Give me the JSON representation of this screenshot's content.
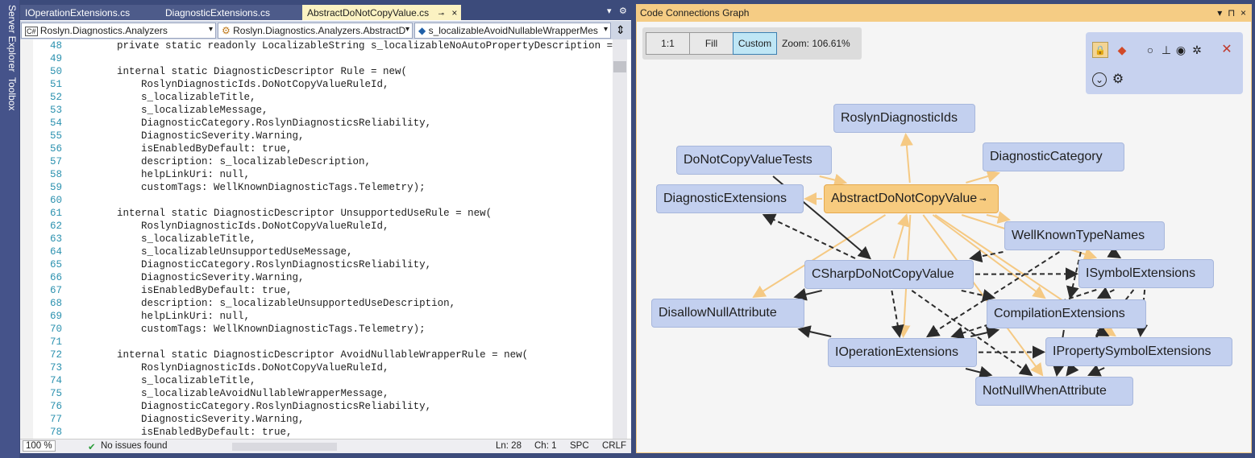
{
  "left_strip": {
    "tabs": [
      "Server Explorer",
      "Toolbox"
    ]
  },
  "editor": {
    "tabs": [
      {
        "label": "IOperationExtensions.cs",
        "active": false
      },
      {
        "label": "DiagnosticExtensions.cs",
        "active": false
      },
      {
        "label": "AbstractDoNotCopyValue.cs",
        "active": true
      }
    ],
    "tab_pin_icon": "pin-icon",
    "tab_close_glyph": "×",
    "tab_tools": {
      "dropdown": "▾",
      "settings": "⚙"
    },
    "nav": {
      "project": "Roslyn.Diagnostics.Analyzers",
      "project_badge": "C#",
      "type": "Roslyn.Diagnostics.Analyzers.AbstractD",
      "member": "s_localizableAvoidNullableWrapperMes",
      "split_glyph": "⇕"
    },
    "lines": [
      {
        "n": "48",
        "t": "    private static readonly LocalizableString s_localizableNoAutoPropertyDescription = n"
      },
      {
        "n": "49",
        "t": ""
      },
      {
        "n": "50",
        "t": "    internal static DiagnosticDescriptor Rule = new("
      },
      {
        "n": "51",
        "t": "        RoslynDiagnosticIds.DoNotCopyValueRuleId,"
      },
      {
        "n": "52",
        "t": "        s_localizableTitle,"
      },
      {
        "n": "53",
        "t": "        s_localizableMessage,"
      },
      {
        "n": "54",
        "t": "        DiagnosticCategory.RoslynDiagnosticsReliability,"
      },
      {
        "n": "55",
        "t": "        DiagnosticSeverity.Warning,"
      },
      {
        "n": "56",
        "t": "        isEnabledByDefault: true,"
      },
      {
        "n": "57",
        "t": "        description: s_localizableDescription,"
      },
      {
        "n": "58",
        "t": "        helpLinkUri: null,"
      },
      {
        "n": "59",
        "t": "        customTags: WellKnownDiagnosticTags.Telemetry);"
      },
      {
        "n": "60",
        "t": ""
      },
      {
        "n": "61",
        "t": "    internal static DiagnosticDescriptor UnsupportedUseRule = new("
      },
      {
        "n": "62",
        "t": "        RoslynDiagnosticIds.DoNotCopyValueRuleId,"
      },
      {
        "n": "63",
        "t": "        s_localizableTitle,"
      },
      {
        "n": "64",
        "t": "        s_localizableUnsupportedUseMessage,"
      },
      {
        "n": "65",
        "t": "        DiagnosticCategory.RoslynDiagnosticsReliability,"
      },
      {
        "n": "66",
        "t": "        DiagnosticSeverity.Warning,"
      },
      {
        "n": "67",
        "t": "        isEnabledByDefault: true,"
      },
      {
        "n": "68",
        "t": "        description: s_localizableUnsupportedUseDescription,"
      },
      {
        "n": "69",
        "t": "        helpLinkUri: null,"
      },
      {
        "n": "70",
        "t": "        customTags: WellKnownDiagnosticTags.Telemetry);"
      },
      {
        "n": "71",
        "t": ""
      },
      {
        "n": "72",
        "t": "    internal static DiagnosticDescriptor AvoidNullableWrapperRule = new("
      },
      {
        "n": "73",
        "t": "        RoslynDiagnosticIds.DoNotCopyValueRuleId,"
      },
      {
        "n": "74",
        "t": "        s_localizableTitle,"
      },
      {
        "n": "75",
        "t": "        s_localizableAvoidNullableWrapperMessage,"
      },
      {
        "n": "76",
        "t": "        DiagnosticCategory.RoslynDiagnosticsReliability,"
      },
      {
        "n": "77",
        "t": "        DiagnosticSeverity.Warning,"
      },
      {
        "n": "78",
        "t": "        isEnabledByDefault: true,"
      }
    ],
    "status": {
      "zoom": "100 %",
      "issues": "No issues found",
      "check_icon": "✔",
      "line": "Ln: 28",
      "col": "Ch: 1",
      "whitespace": "SPC",
      "eol": "CRLF"
    }
  },
  "graph_panel": {
    "title": "Code Connections Graph",
    "header_tools": {
      "dropdown": "▾",
      "pin": "⊓",
      "close": "×"
    },
    "zoom_buttons": {
      "one_to_one": "1:1",
      "fill": "Fill",
      "custom": "Custom"
    },
    "zoom_label": "Zoom: 106.61%",
    "icons": {
      "lock": "🔒",
      "git": "◆",
      "radio_off": "○",
      "hierarchy": "⊥",
      "radio_on": "◉",
      "network": "✲",
      "close": "✕",
      "expand": "⌄",
      "settings": "⚙"
    },
    "colors": {
      "node_fill": "#c3d0ef",
      "main_node_fill": "#f7cb7f",
      "edge_orange": "#f5c983",
      "edge_dark": "#2b2b2b"
    },
    "nodes": [
      {
        "id": "RoslynDiagnosticIds",
        "label": "RoslynDiagnosticIds"
      },
      {
        "id": "DoNotCopyValueTests",
        "label": "DoNotCopyValueTests"
      },
      {
        "id": "DiagnosticCategory",
        "label": "DiagnosticCategory"
      },
      {
        "id": "DiagnosticExtensions",
        "label": "DiagnosticExtensions"
      },
      {
        "id": "AbstractDoNotCopyValue",
        "label": "AbstractDoNotCopyValue",
        "main": true,
        "pin": "⊸"
      },
      {
        "id": "WellKnownTypeNames",
        "label": "WellKnownTypeNames"
      },
      {
        "id": "CSharpDoNotCopyValue",
        "label": "CSharpDoNotCopyValue"
      },
      {
        "id": "ISymbolExtensions",
        "label": "ISymbolExtensions"
      },
      {
        "id": "DisallowNullAttribute",
        "label": "DisallowNullAttribute"
      },
      {
        "id": "CompilationExtensions",
        "label": "CompilationExtensions"
      },
      {
        "id": "IOperationExtensions",
        "label": "IOperationExtensions"
      },
      {
        "id": "IPropertySymbolExtensions",
        "label": "IPropertySymbolExtensions"
      },
      {
        "id": "NotNullWhenAttribute",
        "label": "NotNullWhenAttribute"
      }
    ],
    "edges": [
      {
        "from": "AbstractDoNotCopyValue",
        "to": "RoslynDiagnosticIds",
        "style": "orange"
      },
      {
        "from": "AbstractDoNotCopyValue",
        "to": "DiagnosticCategory",
        "style": "orange"
      },
      {
        "from": "DoNotCopyValueTests",
        "to": "AbstractDoNotCopyValue",
        "style": "orange"
      },
      {
        "from": "AbstractDoNotCopyValue",
        "to": "DiagnosticExtensions",
        "style": "orange"
      },
      {
        "from": "AbstractDoNotCopyValue",
        "to": "WellKnownTypeNames",
        "style": "orange"
      },
      {
        "from": "AbstractDoNotCopyValue",
        "to": "DisallowNullAttribute",
        "style": "orange"
      },
      {
        "from": "AbstractDoNotCopyValue",
        "to": "CompilationExtensions",
        "style": "orange"
      },
      {
        "from": "AbstractDoNotCopyValue",
        "to": "IOperationExtensions",
        "style": "orange"
      },
      {
        "from": "AbstractDoNotCopyValue",
        "to": "ISymbolExtensions",
        "style": "orange"
      },
      {
        "from": "AbstractDoNotCopyValue",
        "to": "IPropertySymbolExtensions",
        "style": "orange"
      },
      {
        "from": "AbstractDoNotCopyValue",
        "to": "NotNullWhenAttribute",
        "style": "orange"
      },
      {
        "from": "CSharpDoNotCopyValue",
        "to": "AbstractDoNotCopyValue",
        "style": "orange"
      },
      {
        "from": "DoNotCopyValueTests",
        "to": "CSharpDoNotCopyValue",
        "style": "solid"
      },
      {
        "from": "CSharpDoNotCopyValue",
        "to": "DisallowNullAttribute",
        "style": "solid"
      },
      {
        "from": "CSharpDoNotCopyValue",
        "to": "DiagnosticExtensions",
        "style": "dashed"
      },
      {
        "from": "CSharpDoNotCopyValue",
        "to": "ISymbolExtensions",
        "style": "dashed"
      },
      {
        "from": "CSharpDoNotCopyValue",
        "to": "CompilationExtensions",
        "style": "dashed"
      },
      {
        "from": "CSharpDoNotCopyValue",
        "to": "IOperationExtensions",
        "style": "dashed"
      },
      {
        "from": "CSharpDoNotCopyValue",
        "to": "NotNullWhenAttribute",
        "style": "dashed"
      },
      {
        "from": "WellKnownTypeNames",
        "to": "CSharpDoNotCopyValue",
        "style": "dashed"
      },
      {
        "from": "WellKnownTypeNames",
        "to": "IOperationExtensions",
        "style": "dashed"
      },
      {
        "from": "WellKnownTypeNames",
        "to": "ISymbolExtensions",
        "style": "dashed"
      },
      {
        "from": "IOperationExtensions",
        "to": "DisallowNullAttribute",
        "style": "solid"
      },
      {
        "from": "IOperationExtensions",
        "to": "NotNullWhenAttribute",
        "style": "solid"
      },
      {
        "from": "IOperationExtensions",
        "to": "CompilationExtensions",
        "style": "solid"
      },
      {
        "from": "IOperationExtensions",
        "to": "IPropertySymbolExtensions",
        "style": "dashed"
      },
      {
        "from": "ISymbolExtensions",
        "to": "IOperationExtensions",
        "style": "dashed"
      },
      {
        "from": "ISymbolExtensions",
        "to": "CompilationExtensions",
        "style": "dashed"
      },
      {
        "from": "ISymbolExtensions",
        "to": "NotNullWhenAttribute",
        "style": "dashed"
      },
      {
        "from": "ISymbolExtensions",
        "to": "IPropertySymbolExtensions",
        "style": "dashed"
      },
      {
        "from": "CompilationExtensions",
        "to": "NotNullWhenAttribute",
        "style": "solid"
      },
      {
        "from": "CompilationExtensions",
        "to": "IPropertySymbolExtensions",
        "style": "dashed"
      },
      {
        "from": "IPropertySymbolExtensions",
        "to": "NotNullWhenAttribute",
        "style": "solid"
      },
      {
        "from": "WellKnownTypeNames",
        "to": "CompilationExtensions",
        "style": "dashed"
      }
    ]
  }
}
